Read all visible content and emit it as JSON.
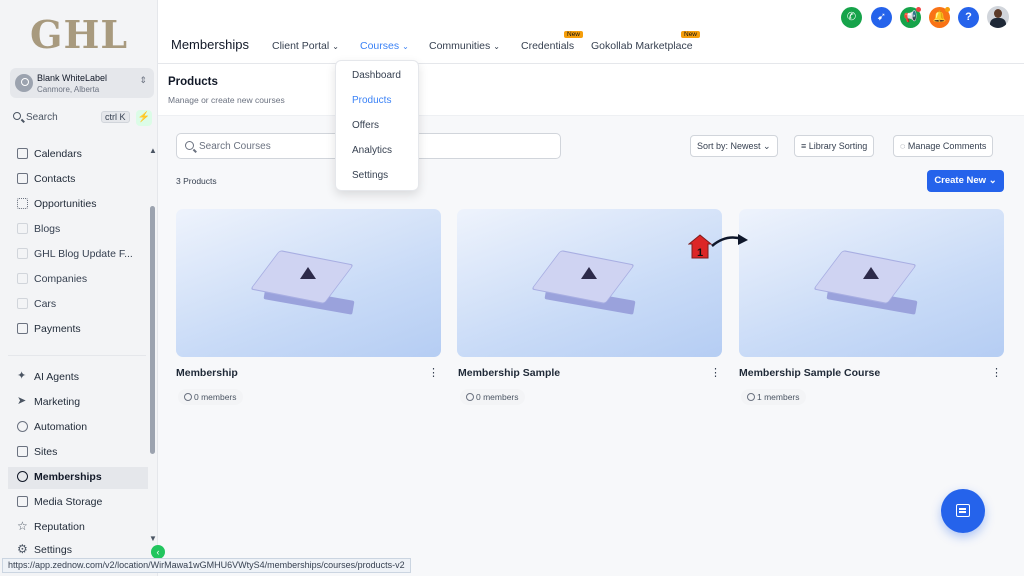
{
  "sidebar": {
    "logo": "GHL",
    "account": {
      "name": "Blank WhiteLabel",
      "location": "Canmore, Alberta"
    },
    "search": {
      "label": "Search",
      "shortcut": "ctrl K"
    },
    "items": [
      {
        "label": "Calendars",
        "icon": "calendar-icon"
      },
      {
        "label": "Contacts",
        "icon": "contacts-icon"
      },
      {
        "label": "Opportunities",
        "icon": "opportunities-icon"
      },
      {
        "label": "Blogs",
        "icon": "cube-icon"
      },
      {
        "label": "GHL Blog Update F...",
        "icon": "cube-icon"
      },
      {
        "label": "Companies",
        "icon": "cube-icon"
      },
      {
        "label": "Cars",
        "icon": "cube-icon"
      },
      {
        "label": "Payments",
        "icon": "payments-icon"
      },
      {
        "label": "AI Agents",
        "icon": "sparkle-icon"
      },
      {
        "label": "Marketing",
        "icon": "send-icon"
      },
      {
        "label": "Automation",
        "icon": "automation-icon"
      },
      {
        "label": "Sites",
        "icon": "sites-icon"
      },
      {
        "label": "Memberships",
        "icon": "badge-icon"
      },
      {
        "label": "Media Storage",
        "icon": "image-icon"
      },
      {
        "label": "Reputation",
        "icon": "star-icon"
      },
      {
        "label": "Settings",
        "icon": "gear-icon"
      }
    ]
  },
  "topbar": {
    "title": "Memberships",
    "nav": [
      {
        "label": "Client Portal"
      },
      {
        "label": "Courses"
      },
      {
        "label": "Communities"
      },
      {
        "label": "Credentials",
        "badge": "New"
      },
      {
        "label": "Gokollab Marketplace",
        "badge": "New"
      }
    ]
  },
  "dropdown": {
    "items": [
      "Dashboard",
      "Products",
      "Offers",
      "Analytics",
      "Settings"
    ],
    "selected": "Products"
  },
  "page": {
    "title": "Products",
    "subtitle": "Manage or create new courses",
    "search_placeholder": "Search Courses",
    "sort_label": "Sort by: Newest",
    "library_sorting": "Library Sorting",
    "manage_comments": "Manage Comments",
    "count": "3 Products",
    "create_new": "Create New"
  },
  "products": [
    {
      "title": "Membership",
      "members": "0 members"
    },
    {
      "title": "Membership Sample",
      "members": "0 members"
    },
    {
      "title": "Membership Sample Course",
      "members": "1 members"
    }
  ],
  "annotation": {
    "number": "1"
  },
  "statusbar": {
    "url": "https://app.zednow.com/v2/location/WirMawa1wGMHU6VWtyS4/memberships/courses/products-v2"
  },
  "colors": {
    "accent": "#2563eb",
    "active_nav": "#3b82f6",
    "badge": "#f59e0b"
  }
}
